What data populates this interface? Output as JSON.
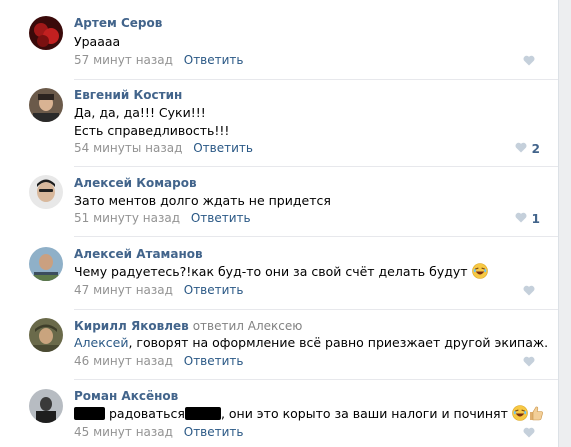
{
  "comments": [
    {
      "author": "Артем Серов",
      "lines": [
        "Ураааа"
      ],
      "time": "57 минут назад",
      "reply": "Ответить",
      "likes": ""
    },
    {
      "author": "Евгений Костин",
      "lines": [
        "Да, да, да!!! Суки!!!",
        "Есть справедливость!!!"
      ],
      "time": "54 минуты назад",
      "reply": "Ответить",
      "likes": "2"
    },
    {
      "author": "Алексей Комаров",
      "lines": [
        "Зато ментов долго ждать не придется"
      ],
      "time": "51 минуту назад",
      "reply": "Ответить",
      "likes": "1"
    },
    {
      "author": "Алексей Атаманов",
      "lines": [
        "Чему радуетесь?!как буд-то они за свой счёт делать будут"
      ],
      "time": "47 минут назад",
      "reply": "Ответить",
      "likes": ""
    },
    {
      "author": "Кирилл Яковлев",
      "reply_to": "ответил Алексею",
      "mention": "Алексей",
      "lines": [
        ", говорят на оформление всё равно приезжает другой экипаж."
      ],
      "time": "46 минут назад",
      "reply": "Ответить",
      "likes": ""
    },
    {
      "author": "Роман Аксёнов",
      "text_part1": "радоваться",
      "text_part2": ", они это корыто за ваши налоги и починят",
      "time": "45 минут назад",
      "reply": "Ответить",
      "likes": ""
    }
  ],
  "icons": {
    "like": "heart-icon",
    "laugh": "laughing-emoji-icon",
    "thumb": "thumbs-up-emoji-icon"
  },
  "colors": {
    "author": "#42648b",
    "link": "#2a5885",
    "meta": "#939393",
    "heart": "#c5d0db"
  }
}
